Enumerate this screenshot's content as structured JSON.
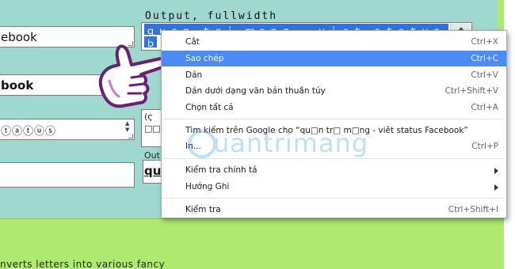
{
  "inputs": {
    "field1": "ebook",
    "field2": "book",
    "field3": "ⓣⓐⓣⓤⓢ"
  },
  "output": {
    "label": "Output, fullwidth",
    "selected_line1": "ｑｕａｎ ｔｒｉ ｍａｎｇ - ｖｉｅｔ ｓｔａｔｕｓ Ｆａｃｅ",
    "selected_line2": "ｂ",
    "field_b_line1": "(ϛ",
    "field_b_line2": "□□",
    "label_c": "Outp",
    "field_c_value": "qua"
  },
  "bottom_text": "nverts letters into various fancy",
  "context_menu": {
    "items": [
      {
        "label": "Cắt",
        "shortcut": "Ctrl+X"
      },
      {
        "label": "Sao chép",
        "shortcut": "Ctrl+C"
      },
      {
        "label": "Dán",
        "shortcut": "Ctrl+V"
      },
      {
        "label": "Dán dưới dạng văn bản thuần túy",
        "shortcut": "Ctrl+Shift+V"
      },
      {
        "label": "Chọn tất cả",
        "shortcut": "Ctrl+A"
      },
      {
        "label": "Tìm kiếm trên Google cho “qu□n tr□ m□ng - viêt status Facebook”",
        "shortcut": ""
      },
      {
        "label": "In...",
        "shortcut": "Ctrl+P"
      },
      {
        "label": "Kiểm tra chính tả",
        "shortcut": ""
      },
      {
        "label": "Hướng Ghi",
        "shortcut": ""
      },
      {
        "label": "Kiểm tra",
        "shortcut": "Ctrl+Shift+I"
      }
    ]
  },
  "watermark": {
    "text": "uantrimang",
    "logo_letter": "Q"
  },
  "colors": {
    "page_bg": "#9fd8ce",
    "bottom_bg": "#afe96f",
    "selection": "#3373d9",
    "menu_highlight": "#4c8bf5"
  },
  "icons": [
    "pointing-hand-icon",
    "submenu-arrow-icon",
    "scroll-up-icon"
  ]
}
